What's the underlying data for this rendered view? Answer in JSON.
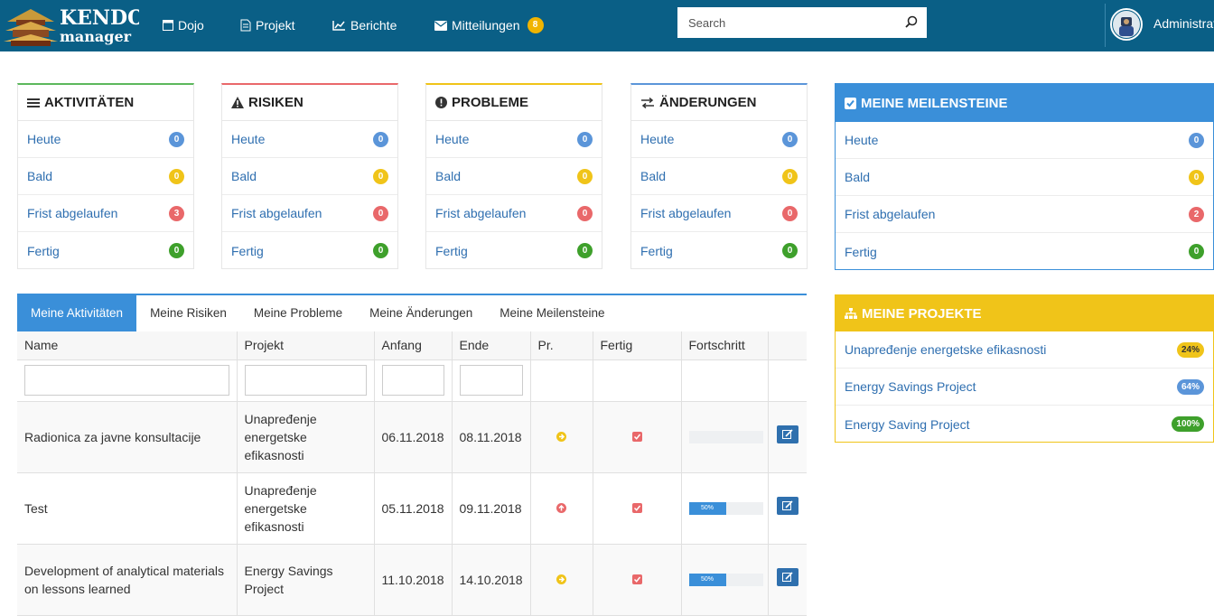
{
  "nav": {
    "items": [
      {
        "label": "Dojo",
        "icon": "window-icon"
      },
      {
        "label": "Projekt",
        "icon": "document-icon"
      },
      {
        "label": "Berichte",
        "icon": "line-chart-icon"
      },
      {
        "label": "Mitteilungen",
        "icon": "envelope-icon",
        "badge": "8"
      }
    ],
    "search_placeholder": "Search",
    "user": "Administrator"
  },
  "cards": [
    {
      "title": "AKTIVITÄTEN",
      "icon": "list-icon",
      "accent": "#5cb85c",
      "rows": [
        {
          "label": "Heute",
          "count": "0",
          "color": "#5b95d9"
        },
        {
          "label": "Bald",
          "count": "0",
          "color": "#f0c419"
        },
        {
          "label": "Frist abgelaufen",
          "count": "3",
          "color": "#e9686a"
        },
        {
          "label": "Fertig",
          "count": "0",
          "color": "#3ea02b"
        }
      ]
    },
    {
      "title": "RISIKEN",
      "icon": "warning-icon",
      "accent": "#e9686a",
      "rows": [
        {
          "label": "Heute",
          "count": "0",
          "color": "#5b95d9"
        },
        {
          "label": "Bald",
          "count": "0",
          "color": "#f0c419"
        },
        {
          "label": "Frist abgelaufen",
          "count": "0",
          "color": "#e9686a"
        },
        {
          "label": "Fertig",
          "count": "0",
          "color": "#3ea02b"
        }
      ]
    },
    {
      "title": "PROBLEME",
      "icon": "exclamation-circle-icon",
      "accent": "#f0c419",
      "rows": [
        {
          "label": "Heute",
          "count": "0",
          "color": "#5b95d9"
        },
        {
          "label": "Bald",
          "count": "0",
          "color": "#f0c419"
        },
        {
          "label": "Frist abgelaufen",
          "count": "0",
          "color": "#e9686a"
        },
        {
          "label": "Fertig",
          "count": "0",
          "color": "#3ea02b"
        }
      ]
    },
    {
      "title": "ÄNDERUNGEN",
      "icon": "exchange-icon",
      "accent": "#5b95d9",
      "rows": [
        {
          "label": "Heute",
          "count": "0",
          "color": "#5b95d9"
        },
        {
          "label": "Bald",
          "count": "0",
          "color": "#f0c419"
        },
        {
          "label": "Frist abgelaufen",
          "count": "0",
          "color": "#e9686a"
        },
        {
          "label": "Fertig",
          "count": "0",
          "color": "#3ea02b"
        }
      ]
    }
  ],
  "milestones": {
    "title": "MEINE MEILENSTEINE",
    "icon": "checkbox-icon",
    "accent": "#3a8fd9",
    "rows": [
      {
        "label": "Heute",
        "count": "0",
        "color": "#5b95d9"
      },
      {
        "label": "Bald",
        "count": "0",
        "color": "#f0c419"
      },
      {
        "label": "Frist abgelaufen",
        "count": "2",
        "color": "#e9686a"
      },
      {
        "label": "Fertig",
        "count": "0",
        "color": "#3ea02b"
      }
    ]
  },
  "projects": {
    "title": "MEINE PROJEKTE",
    "icon": "sitemap-icon",
    "accent": "#f0c419",
    "rows": [
      {
        "name": "Unapređenje energetske efikasnosti",
        "pct": "24%",
        "color": "#f0c419",
        "text": "#333"
      },
      {
        "name": "Energy Savings Project",
        "pct": "64%",
        "color": "#5b95d9",
        "text": "#fff"
      },
      {
        "name": "Energy Saving Project",
        "pct": "100%",
        "color": "#3ea02b",
        "text": "#fff"
      }
    ]
  },
  "tabs": [
    "Meine Aktivitäten",
    "Meine Risiken",
    "Meine Probleme",
    "Meine Änderungen",
    "Meine Meilensteine"
  ],
  "table": {
    "columns": [
      "Name",
      "Projekt",
      "Anfang",
      "Ende",
      "Pr.",
      "Fertig",
      "Fortschritt",
      ""
    ],
    "rows": [
      {
        "name": "Radionica za javne konsultacije",
        "project": "Unapređenje energetske efikasnosti",
        "start": "06.11.2018",
        "end": "08.11.2018",
        "priority": "normal-priority-icon",
        "done": true,
        "progress": 0,
        "progress_label": ""
      },
      {
        "name": "Test",
        "project": "Unapređenje energetske efikasnosti",
        "start": "05.11.2018",
        "end": "09.11.2018",
        "priority": "high-priority-icon",
        "done": true,
        "progress": 0.5,
        "progress_label": "50%"
      },
      {
        "name": "Development of analytical materials on lessons learned",
        "project": "Energy Savings Project",
        "start": "11.10.2018",
        "end": "14.10.2018",
        "priority": "normal-priority-icon",
        "done": true,
        "progress": 0.5,
        "progress_label": "50%"
      }
    ]
  }
}
